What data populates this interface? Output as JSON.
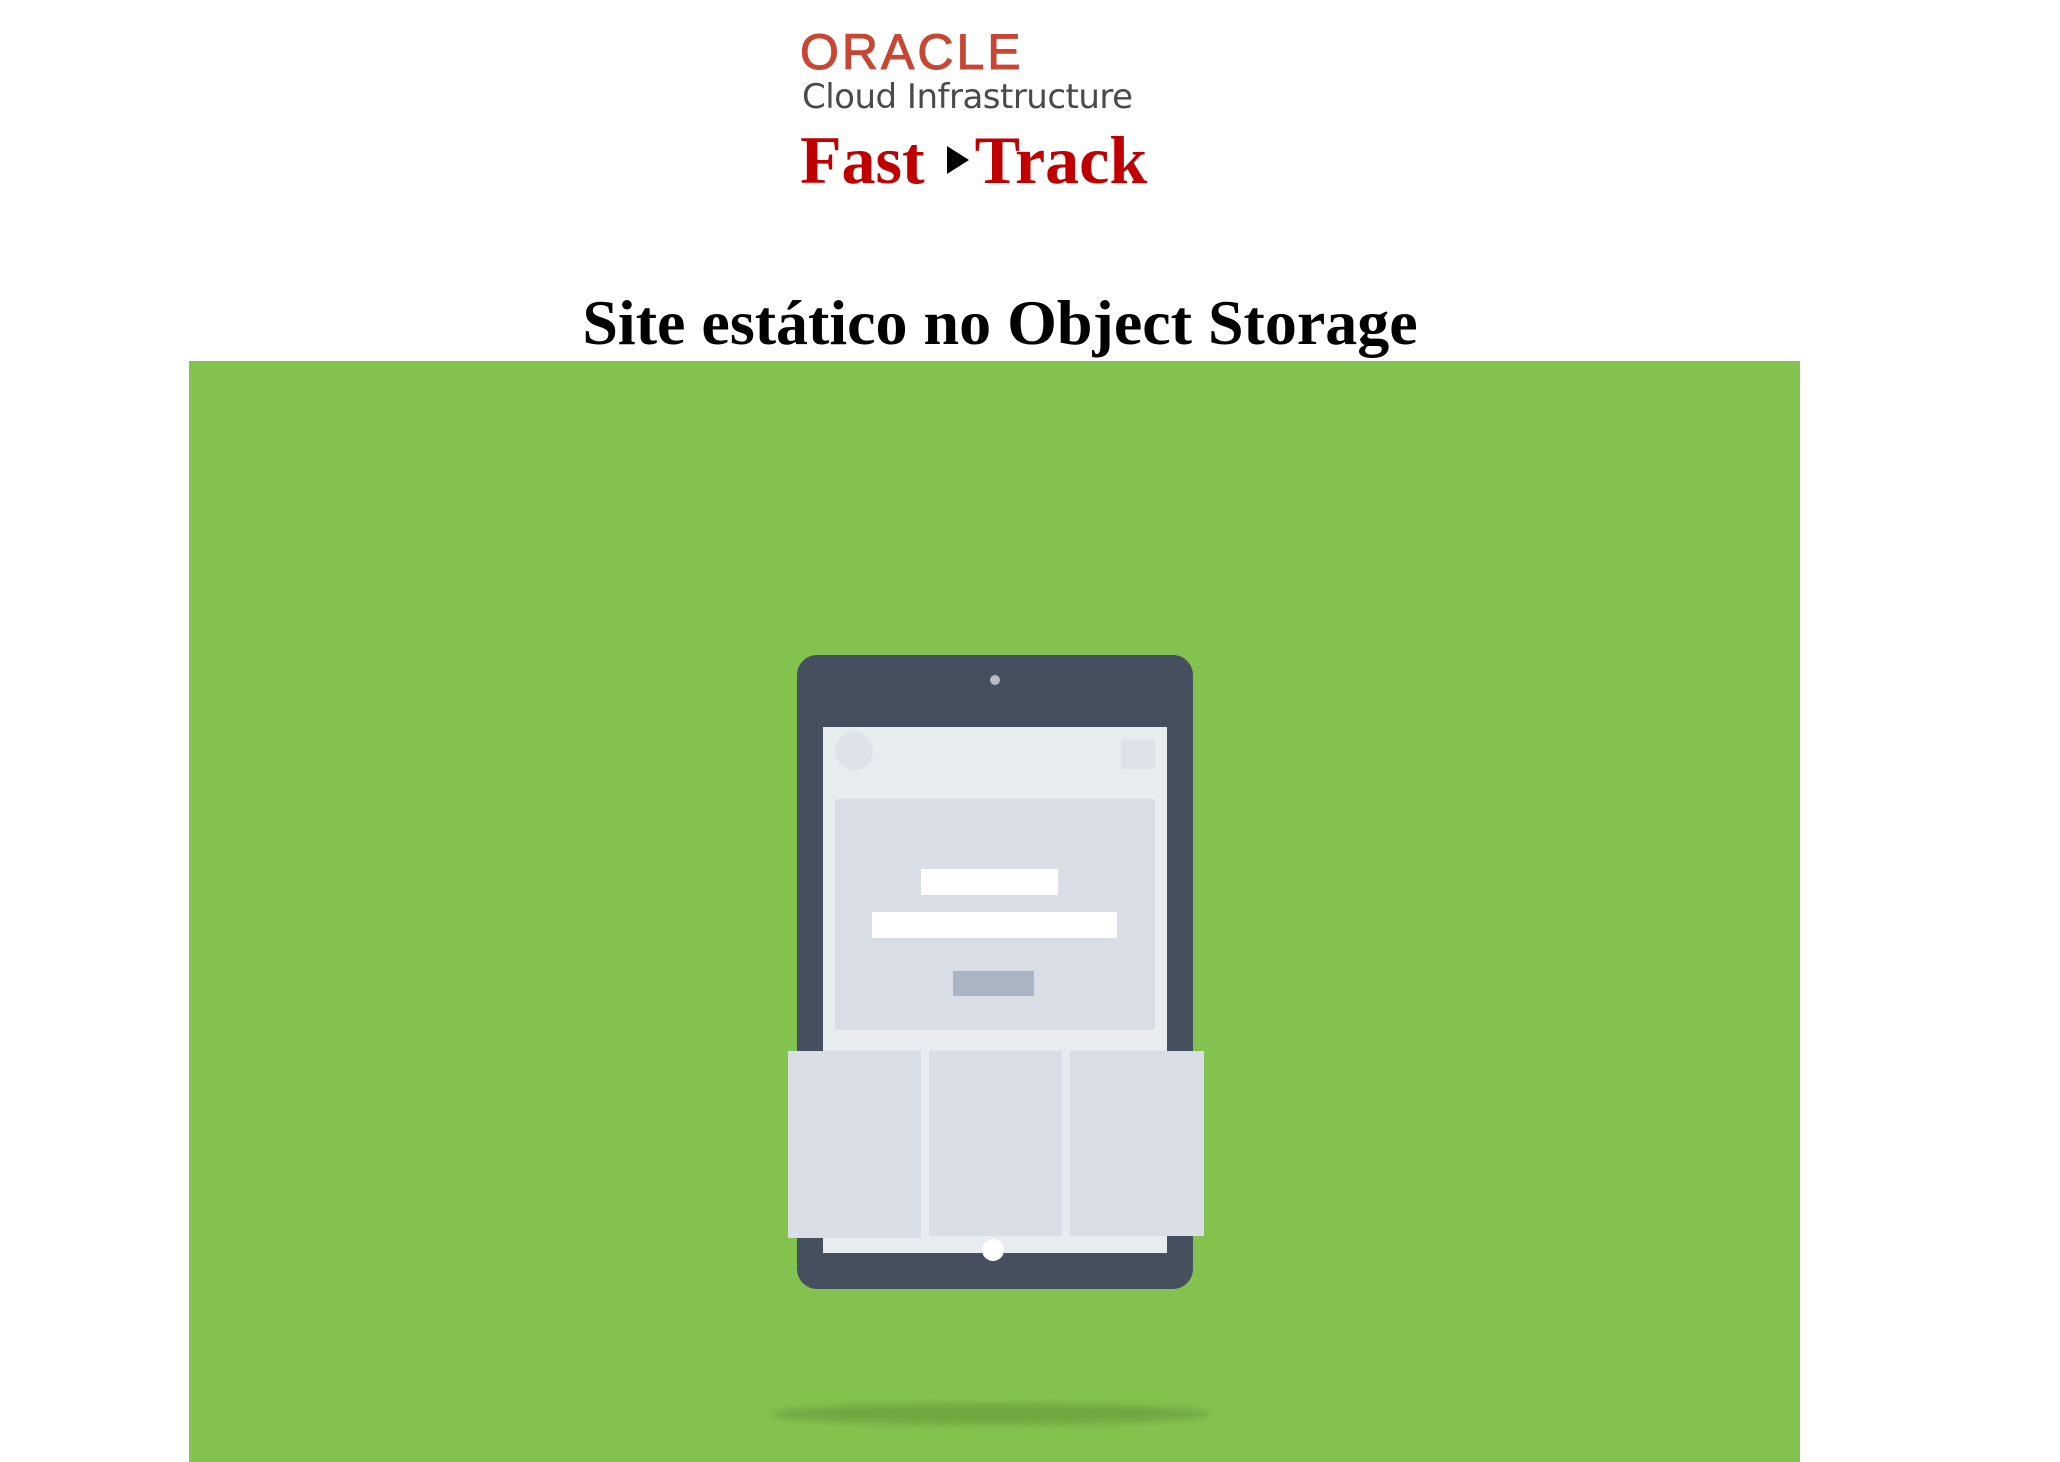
{
  "logo": {
    "brand": "ORACLE",
    "product": "Cloud Infrastructure",
    "program_left": "Fast",
    "program_right": "Track",
    "colors": {
      "oracle_red": "#c74634",
      "fasttrack_red": "#c00000",
      "cloud_gray": "#4a4a4a"
    }
  },
  "page": {
    "title": "Site estático no Object Storage"
  },
  "hero": {
    "background_color": "#84c250",
    "device_color": "#464f5d",
    "icon": "tablet-illustration-icon"
  }
}
